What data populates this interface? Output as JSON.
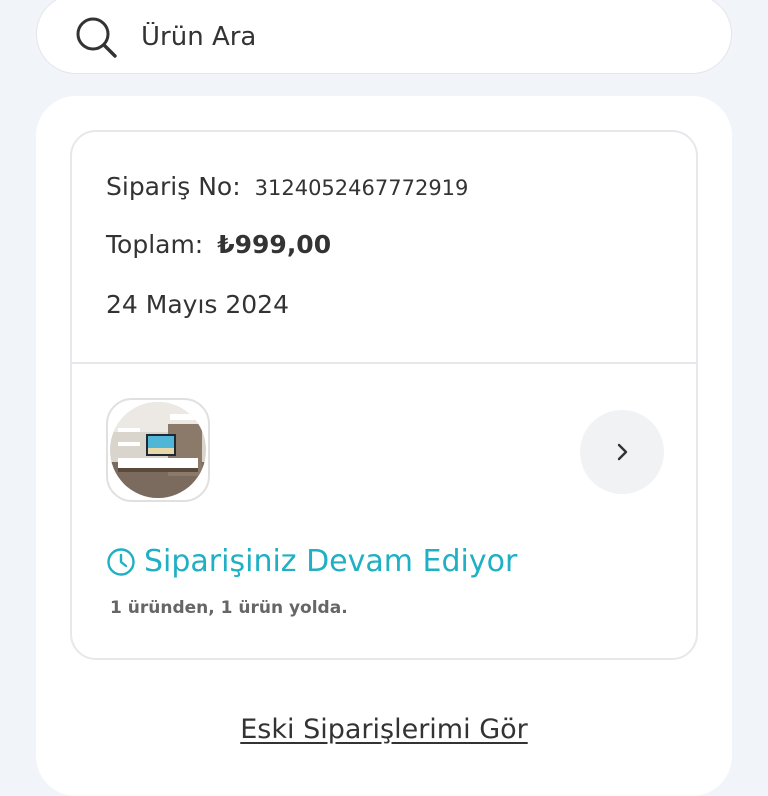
{
  "search": {
    "placeholder": "Ürün Ara"
  },
  "order": {
    "order_no_label": "Sipariş No:",
    "order_no_value": "3124052467772919",
    "total_label": "Toplam:",
    "total_value": "₺999,00",
    "date": "24 Mayıs 2024",
    "product_image_icon": "tv-unit-product-image",
    "status_icon": "clock-icon",
    "status_text": "Siparişiniz Devam Ediyor",
    "status_detail": "1 üründen, 1 ürün yolda.",
    "chevron_icon": "chevron-right-icon"
  },
  "footer": {
    "old_orders_link": "Eski Siparişlerimi Gör"
  },
  "colors": {
    "accent": "#1fb0c4",
    "text": "#333333",
    "background": "#f1f4f9"
  }
}
